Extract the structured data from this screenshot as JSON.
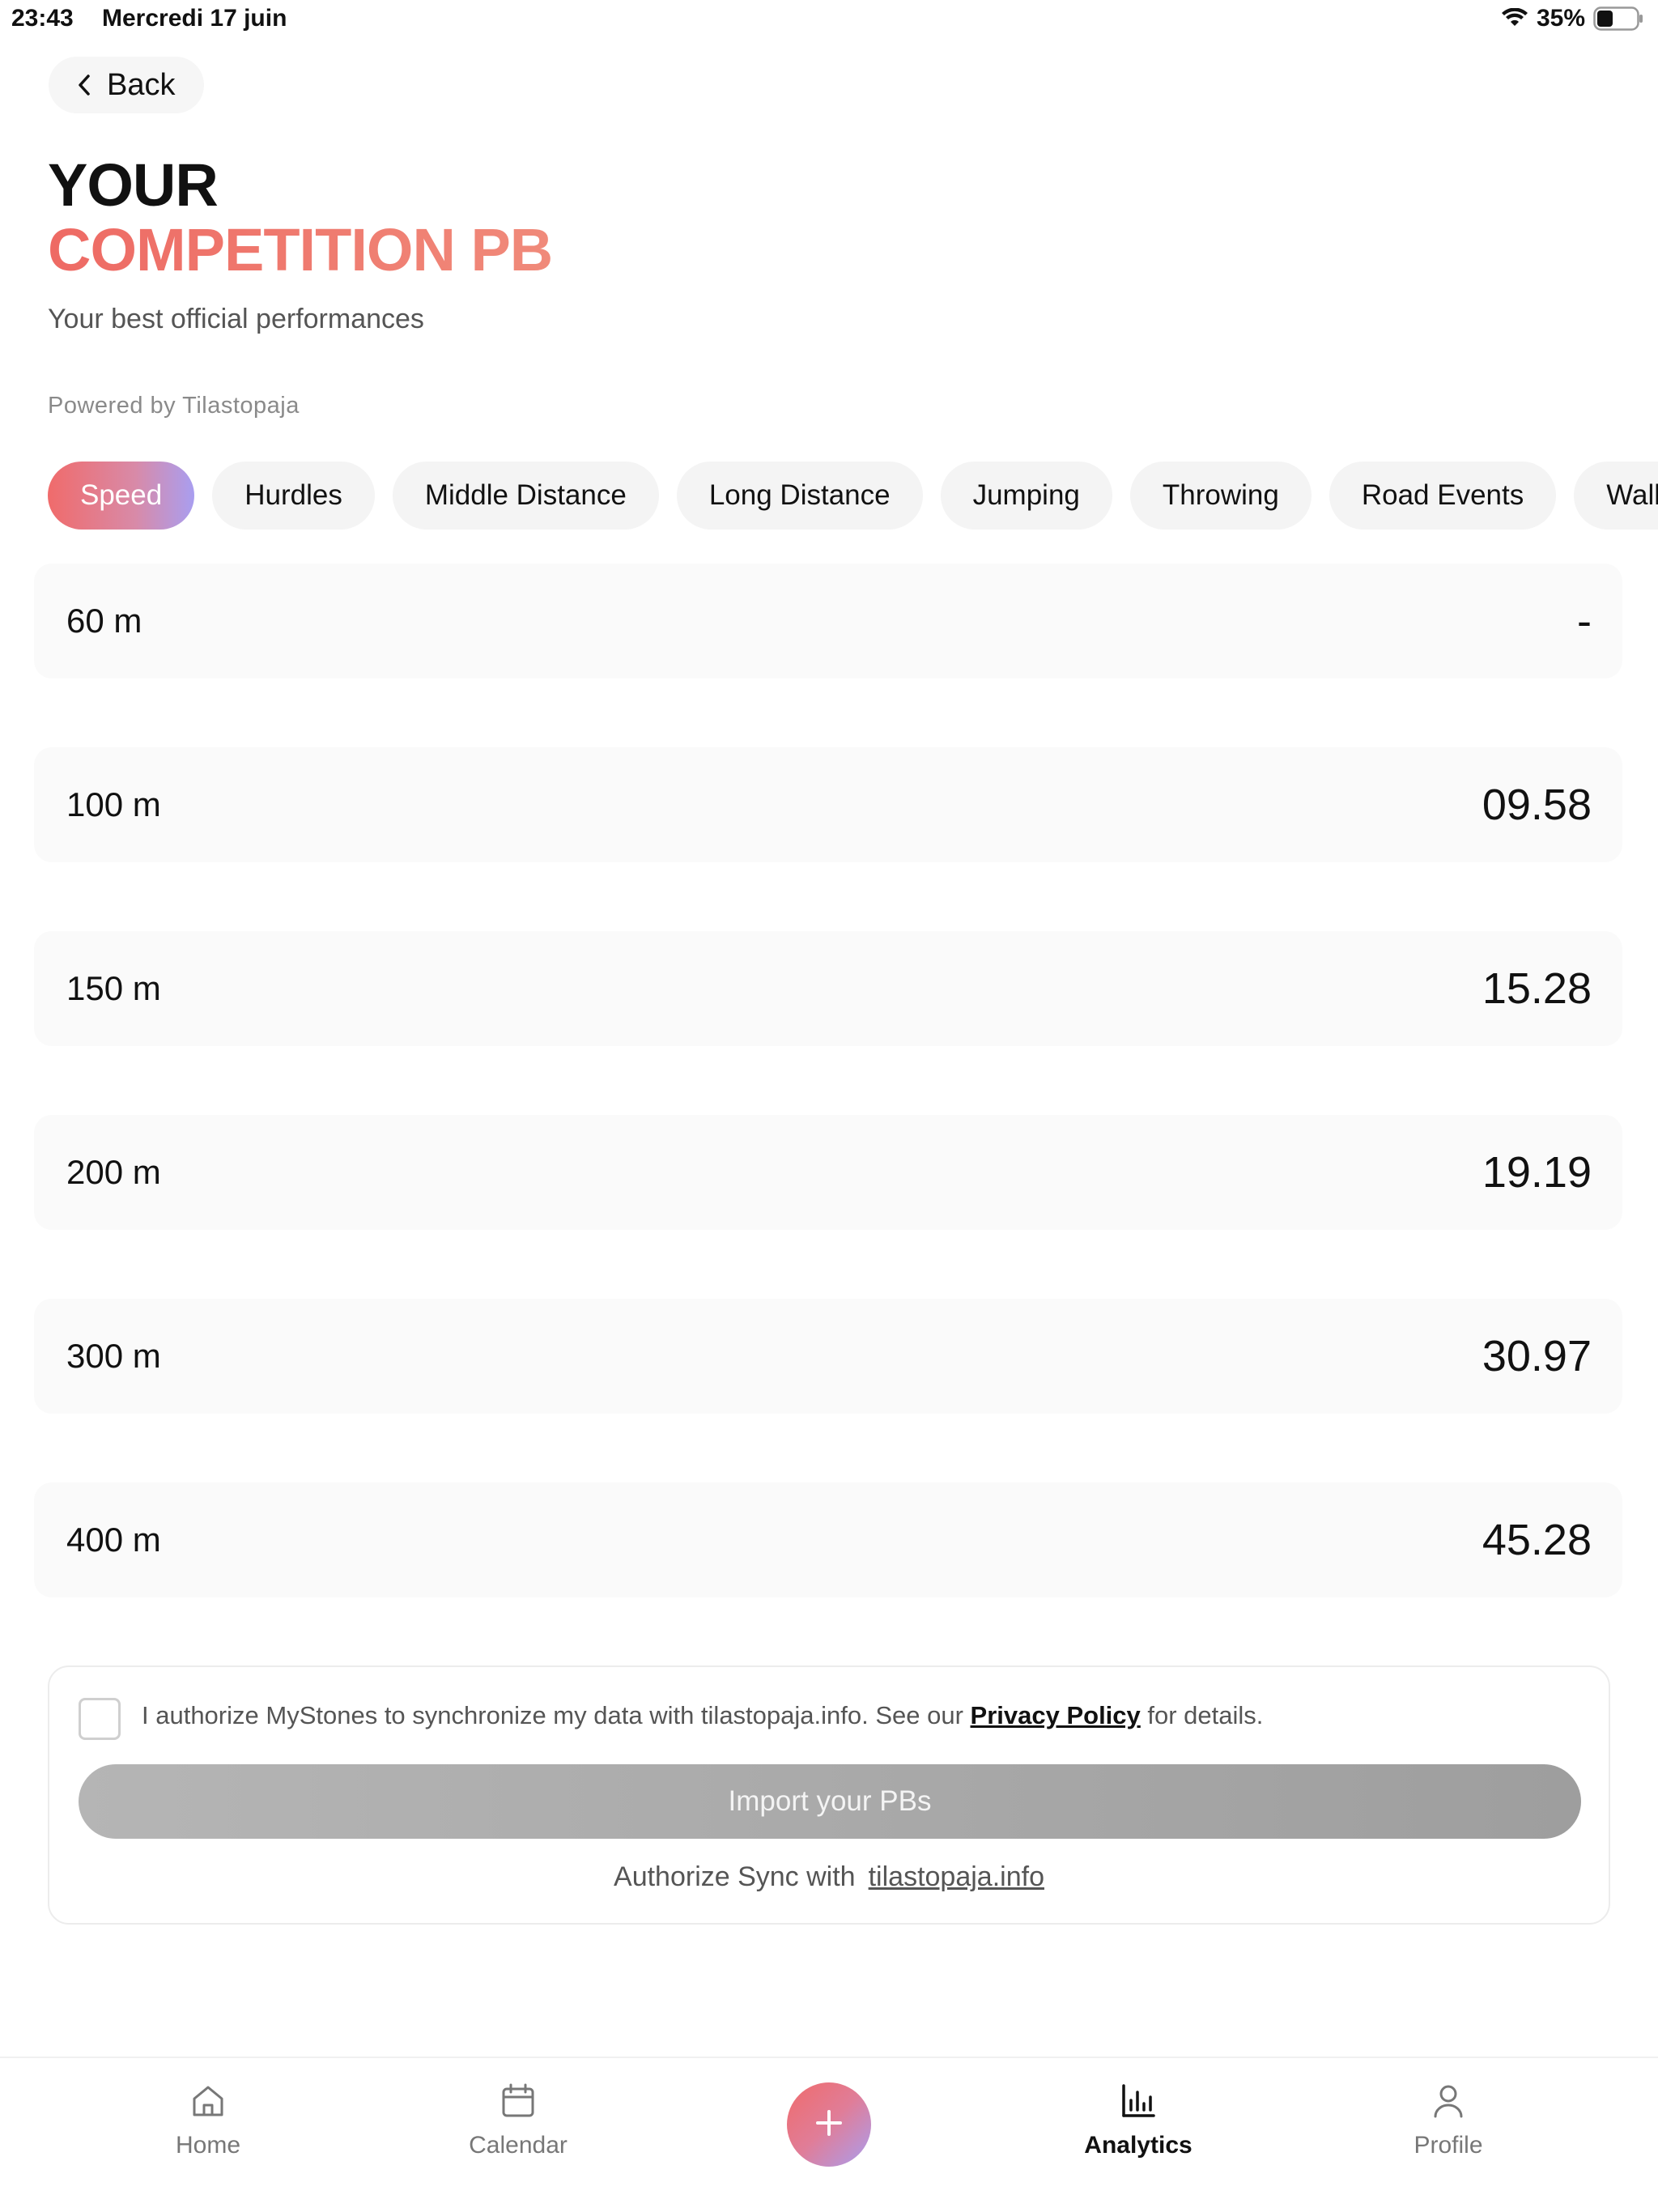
{
  "status_bar": {
    "time": "23:43",
    "date": "Mercredi 17 juin",
    "battery": "35%"
  },
  "header": {
    "back_label": "Back",
    "title_line1": "YOUR",
    "title_line2": "COMPETITION PB",
    "subtitle": "Your best official performances",
    "powered_by": "Powered by Tilastopaja"
  },
  "tabs": [
    {
      "label": "Speed",
      "active": true
    },
    {
      "label": "Hurdles"
    },
    {
      "label": "Middle Distance"
    },
    {
      "label": "Long Distance"
    },
    {
      "label": "Jumping"
    },
    {
      "label": "Throwing"
    },
    {
      "label": "Road Events"
    },
    {
      "label": "Walk"
    }
  ],
  "pbs": [
    {
      "event": "60 m",
      "value": "-"
    },
    {
      "event": "100 m",
      "value": "09.58"
    },
    {
      "event": "150 m",
      "value": "15.28"
    },
    {
      "event": "200 m",
      "value": "19.19"
    },
    {
      "event": "300 m",
      "value": "30.97"
    },
    {
      "event": "400 m",
      "value": "45.28"
    }
  ],
  "sync": {
    "consent_prefix": "I authorize MyStones to synchronize my data with tilastopaja.info. See our ",
    "privacy_link": "Privacy Policy",
    "consent_suffix": " for details.",
    "import_label": "Import your PBs",
    "authorize_text": "Authorize Sync with",
    "authorize_link": "tilastopaja.info"
  },
  "nav": {
    "home": "Home",
    "calendar": "Calendar",
    "analytics": "Analytics",
    "profile": "Profile"
  },
  "colors": {
    "accent_start": "#f06b6b",
    "accent_end": "#a99ef0",
    "title_accent": "#ee6a64"
  }
}
